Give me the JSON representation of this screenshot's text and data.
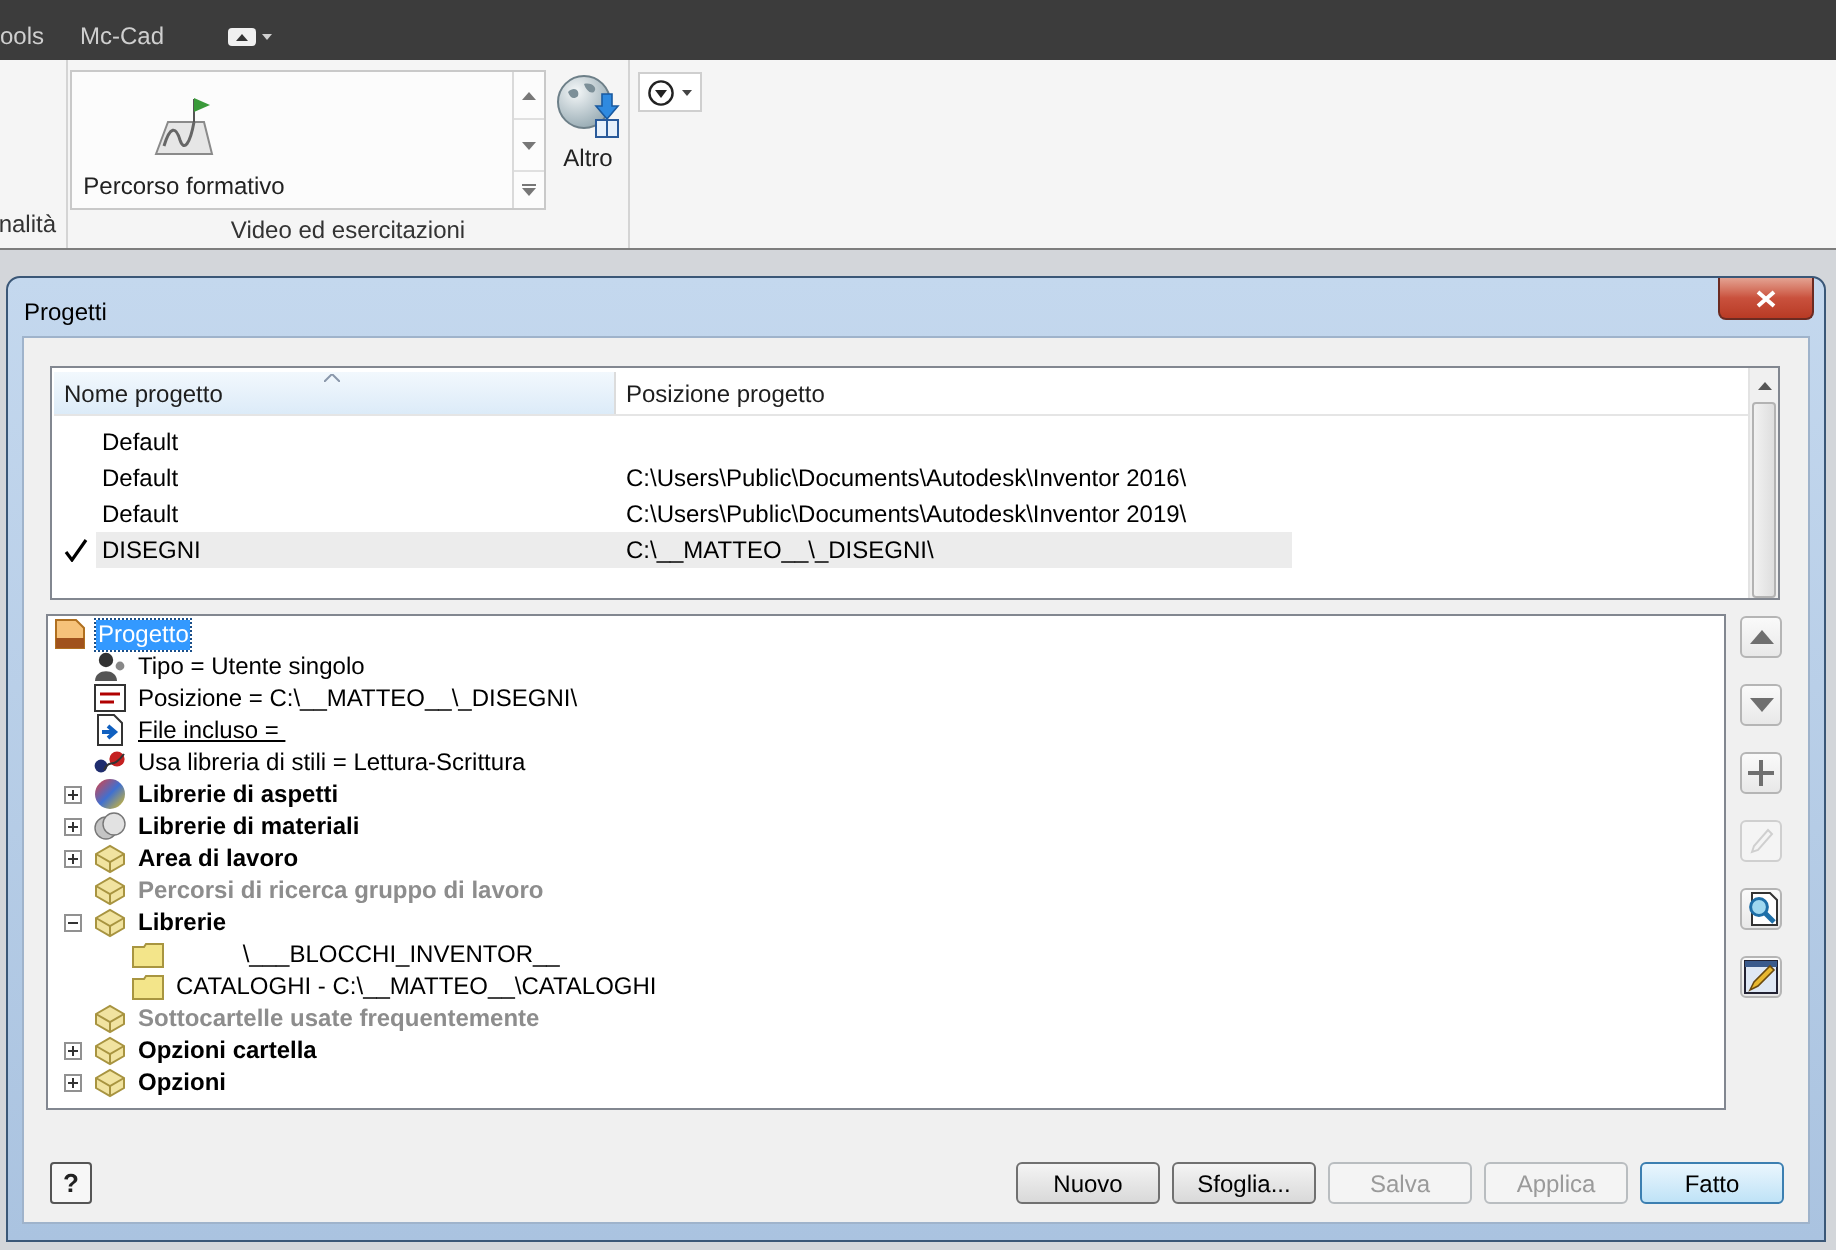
{
  "app_tabs": [
    {
      "label": "ools",
      "selected": false
    },
    {
      "label": "Mc-Cad",
      "selected": false
    }
  ],
  "ribbon": {
    "left_panel": {
      "label": "nalità"
    },
    "panel": {
      "label": "Video ed esercitazioni",
      "gallery": [
        {
          "label": "Percorso formativo"
        }
      ],
      "more_button": {
        "label": "Altro"
      }
    }
  },
  "dialog": {
    "title": "Progetti",
    "project_list": {
      "columns": [
        {
          "label": "Nome progetto",
          "sorted": true
        },
        {
          "label": "Posizione progetto",
          "sorted": false
        }
      ],
      "rows": [
        {
          "name": "Default",
          "active": false,
          "selected": false
        },
        {
          "name": "Default",
          "location": "C:\\Users\\Public\\Documents\\Autodesk\\Inventor 2016\\",
          "active": false,
          "selected": false
        },
        {
          "name": "Default",
          "location": "C:\\Users\\Public\\Documents\\Autodesk\\Inventor 2019\\",
          "active": false,
          "selected": false
        },
        {
          "name": "DISEGNI",
          "location": "C:\\__MATTEO__\\_DISEGNI\\",
          "active": true,
          "selected": true
        }
      ]
    },
    "tree": [
      {
        "label": "Progetto",
        "kind": "project",
        "selected": true,
        "disabled": false,
        "children": [
          {
            "label": "Tipo = Utente singolo",
            "kind": "user",
            "selected": false,
            "disabled": false
          },
          {
            "label": "Posizione = C:\\__MATTEO__\\_DISEGNI\\",
            "kind": "text",
            "selected": false,
            "disabled": false
          },
          {
            "label": "File incluso = ",
            "kind": "include",
            "selected": false,
            "disabled": false
          },
          {
            "label": "Usa libreria di stili = Lettura-Scrittura",
            "kind": "styles",
            "selected": false,
            "disabled": false
          },
          {
            "label": "Librerie di aspetti",
            "kind": "appearance",
            "selected": false,
            "disabled": false,
            "expanded": false
          },
          {
            "label": "Librerie di materiali",
            "kind": "material",
            "selected": false,
            "disabled": false,
            "expanded": false
          },
          {
            "label": "Area di lavoro",
            "kind": "group",
            "selected": false,
            "disabled": false,
            "expanded": false
          },
          {
            "label": "Percorsi di ricerca gruppo di lavoro",
            "kind": "group",
            "selected": false,
            "disabled": true
          },
          {
            "label": "Librerie",
            "kind": "group",
            "selected": false,
            "disabled": false,
            "expanded": true,
            "children": [
              {
                "label": "          \\___BLOCCHI_INVENTOR__",
                "kind": "folder",
                "selected": false,
                "disabled": false
              },
              {
                "label": "CATALOGHI - C:\\__MATTEO__\\CATALOGHI",
                "kind": "folder",
                "selected": false,
                "disabled": false
              }
            ]
          },
          {
            "label": "Sottocartelle usate frequentemente",
            "kind": "group",
            "selected": false,
            "disabled": true
          },
          {
            "label": "Opzioni cartella",
            "kind": "group",
            "selected": false,
            "disabled": false,
            "expanded": false
          },
          {
            "label": "Opzioni",
            "kind": "group",
            "selected": false,
            "disabled": false,
            "expanded": false
          }
        ]
      }
    ],
    "side_buttons": [
      {
        "kind": "up",
        "disabled": false
      },
      {
        "kind": "down",
        "disabled": false
      },
      {
        "kind": "add",
        "disabled": false
      },
      {
        "kind": "edit",
        "disabled": true
      },
      {
        "kind": "find",
        "disabled": false
      },
      {
        "kind": "properties",
        "disabled": false
      }
    ],
    "help_button": {
      "label": "?"
    },
    "buttons": [
      {
        "label": "Nuovo",
        "disabled": false,
        "default": false
      },
      {
        "label": "Sfoglia...",
        "disabled": false,
        "default": false
      },
      {
        "label": "Salva",
        "disabled": true,
        "default": false
      },
      {
        "label": "Applica",
        "disabled": true,
        "default": false
      },
      {
        "label": "Fatto",
        "disabled": false,
        "default": true
      }
    ]
  }
}
